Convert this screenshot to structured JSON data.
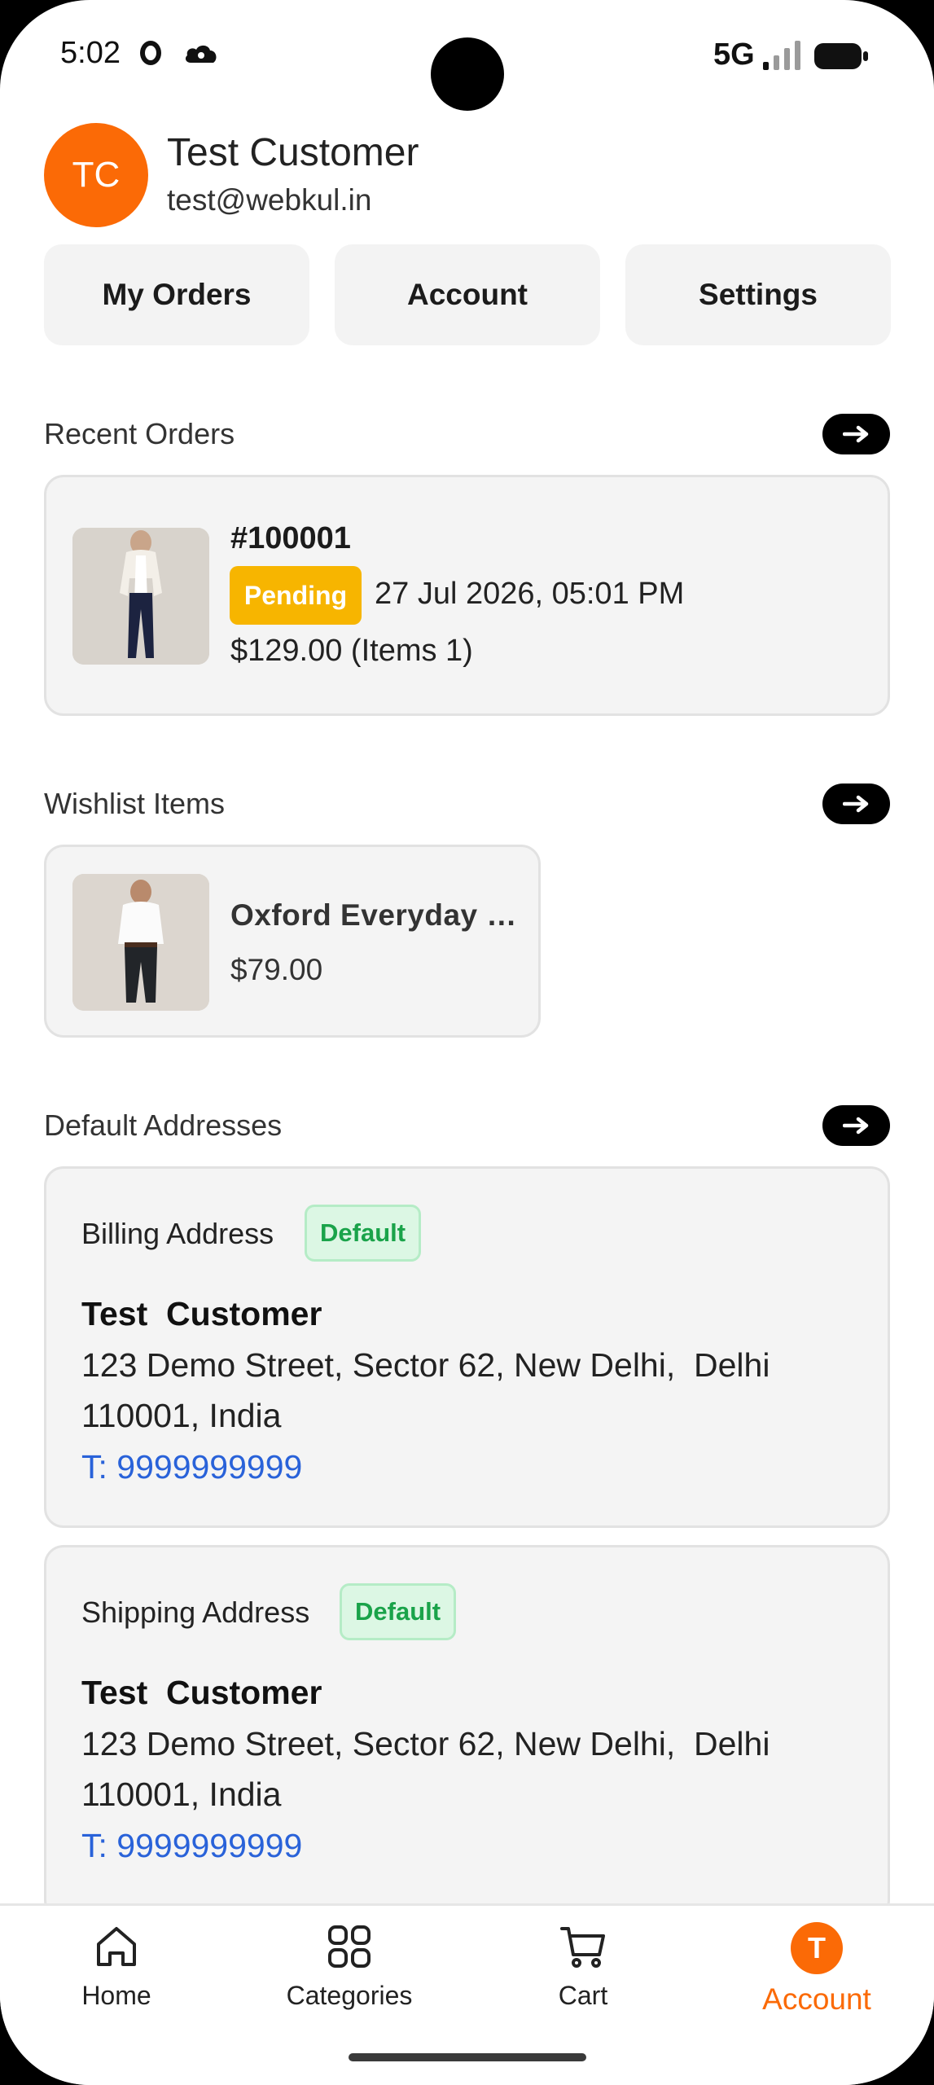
{
  "status_bar": {
    "time": "5:02",
    "network": "5G",
    "icons": [
      "ring-icon",
      "cloud-icon",
      "signal-icon",
      "battery-icon"
    ]
  },
  "profile": {
    "initials": "TC",
    "name": "Test Customer",
    "email": "test@webkul.in",
    "avatar_color": "#fb6a06"
  },
  "quick_actions": [
    {
      "label": "My Orders"
    },
    {
      "label": "Account"
    },
    {
      "label": "Settings"
    }
  ],
  "recent_orders": {
    "title": "Recent Orders",
    "orders": [
      {
        "id": "#100001",
        "status": "Pending",
        "status_color": "#f7b500",
        "date": "27 Jul 2026, 05:01 PM",
        "total": "$129.00 (Items 1)"
      }
    ]
  },
  "wishlist": {
    "title": "Wishlist Items",
    "items": [
      {
        "name": "Oxford Everyday …",
        "price": "$79.00"
      }
    ]
  },
  "addresses": {
    "title": "Default Addresses",
    "billing": {
      "label": "Billing Address",
      "badge": "Default",
      "name": "Test  Customer",
      "line": "123 Demo Street, Sector 62, New Delhi,  Delhi 110001, India",
      "phone": "T: 9999999999"
    },
    "shipping": {
      "label": "Shipping Address",
      "badge": "Default",
      "name": "Test  Customer",
      "line": "123 Demo Street, Sector 62, New Delhi,  Delhi 110001, India",
      "phone": "T: 9999999999"
    }
  },
  "bottom_nav": {
    "items": [
      {
        "label": "Home",
        "icon": "home-icon"
      },
      {
        "label": "Categories",
        "icon": "grid-icon"
      },
      {
        "label": "Cart",
        "icon": "cart-icon"
      },
      {
        "label": "Account",
        "avatar": "T",
        "active": true
      }
    ],
    "active_color": "#fb6a06"
  },
  "colors": {
    "accent": "#fb6a06",
    "link": "#2962d9",
    "success": "#1aa34a",
    "warning": "#f7b500"
  }
}
